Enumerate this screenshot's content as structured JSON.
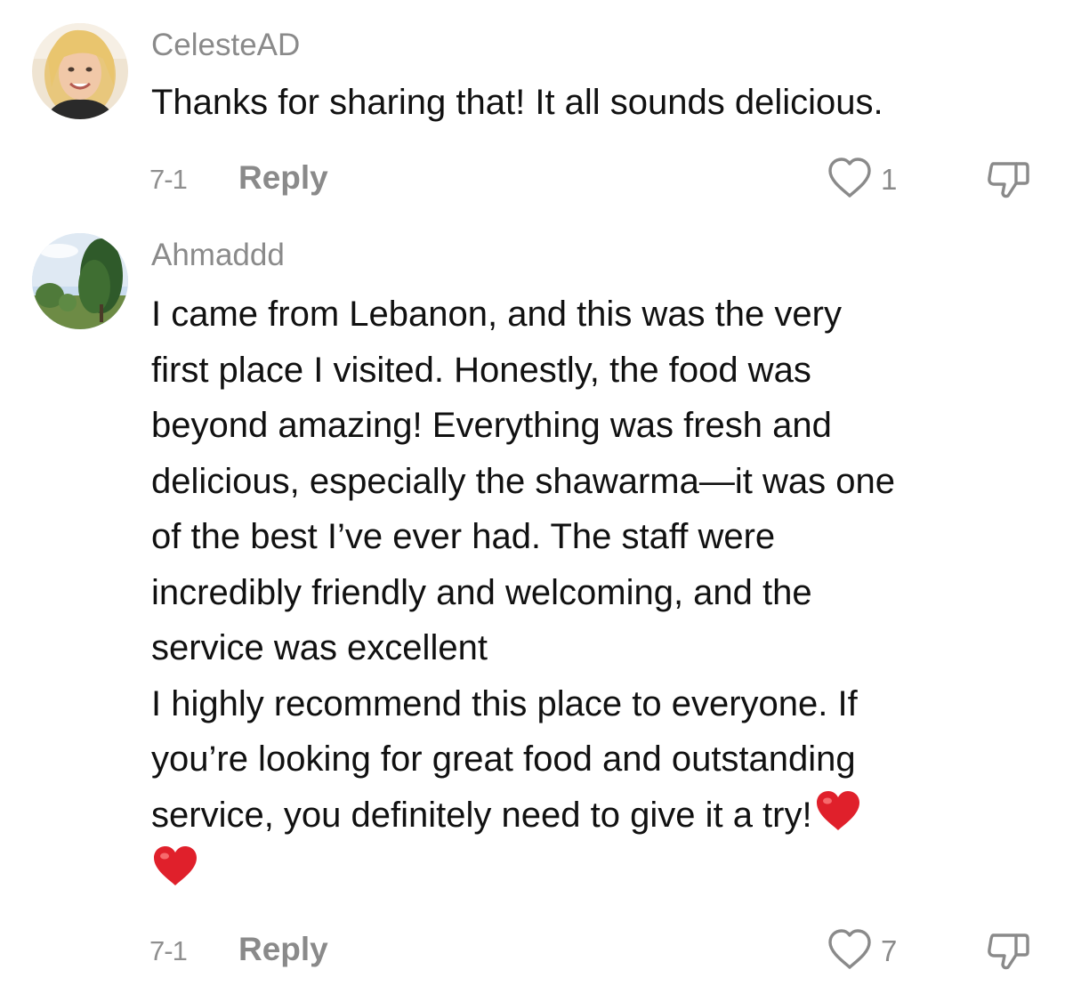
{
  "comments": [
    {
      "username": "CelesteAD",
      "avatar_icon": "user-avatar-photo",
      "lines": [
        "Thanks for sharing that! It all sounds delicious."
      ],
      "date": "7-1",
      "reply_label": "Reply",
      "likes": "1",
      "like_icon": "heart-outline-icon",
      "dislike_icon": "thumbs-down-icon"
    },
    {
      "username": "Ahmaddd",
      "avatar_icon": "user-avatar-photo",
      "lines": [
        "I came from Lebanon, and this was the very",
        "first place I visited. Honestly, the food was",
        "beyond amazing! Everything was fresh and",
        "delicious, especially the shawarma—it was one",
        "of the best I’ve ever had. The staff were",
        "incredibly friendly and welcoming, and the",
        "service was excellent",
        "I highly recommend this place to everyone. If",
        "you’re looking for great food and outstanding",
        "service, you definitely need to give it a try!"
      ],
      "emoji": "red-heart-emoji",
      "date": "7-1",
      "reply_label": "Reply",
      "likes": "7",
      "like_icon": "heart-outline-icon",
      "dislike_icon": "thumbs-down-icon"
    }
  ],
  "colors": {
    "text": "#111111",
    "muted": "#8a8a8a",
    "heart_red": "#e0202b"
  }
}
